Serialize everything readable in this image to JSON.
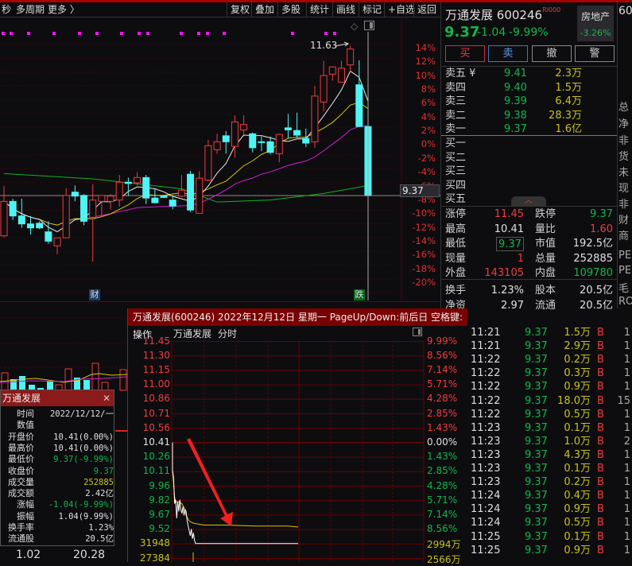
{
  "toolbar": {
    "left": [
      "秒",
      "多周期",
      "更多 〉"
    ],
    "buttons": [
      "复权",
      "叠加",
      "多股",
      "统计",
      "画线",
      "标记",
      "+自选",
      "返回"
    ]
  },
  "kline": {
    "high_label": "11.63",
    "axis": [
      "14%",
      "12%",
      "10%",
      "8%",
      "6%",
      "4%",
      "2%",
      "0%",
      "-2%",
      "-4%",
      "-6%",
      "-8%",
      "-10%",
      "-12%",
      "-14%",
      "-16%",
      "-18%",
      "-20%"
    ],
    "cursor_price": "9.37",
    "badge_cai": "财",
    "badge_die": "跌",
    "bottom_values": [
      "1.02",
      "20.28"
    ]
  },
  "quote": {
    "name": "万通发展",
    "code": "600246",
    "tag": "RI000",
    "price": "9.37",
    "change": "-1.04",
    "pct": "-9.99%",
    "industry": "房地产",
    "industry_pct": "-3.26%",
    "buttons": [
      "买",
      "卖",
      "撤",
      "警"
    ],
    "asks": [
      {
        "label": "卖五 ¥",
        "price": "9.41",
        "vol": "2.3万"
      },
      {
        "label": "卖四",
        "price": "9.40",
        "vol": "1.5万"
      },
      {
        "label": "卖三",
        "price": "9.39",
        "vol": "6.4万"
      },
      {
        "label": "卖二",
        "price": "9.38",
        "vol": "28.3万"
      },
      {
        "label": "卖一",
        "price": "9.37",
        "vol": "1.6亿"
      }
    ],
    "bids": [
      {
        "label": "买一"
      },
      {
        "label": "买二"
      },
      {
        "label": "买三"
      },
      {
        "label": "买四"
      },
      {
        "label": "买五"
      }
    ],
    "collapse": "︿",
    "stats": [
      {
        "l1": "涨停",
        "v1": "11.45",
        "c1": "red",
        "l2": "跌停",
        "v2": "9.37",
        "c2": "green"
      },
      {
        "l1": "最高",
        "v1": "10.41",
        "c1": "white",
        "l2": "量比",
        "v2": "1.60",
        "c2": "red"
      },
      {
        "l1": "最低",
        "v1": "9.37",
        "c1": "green",
        "l2": "市值",
        "v2": "192.5亿",
        "c2": "white"
      },
      {
        "l1": "现量",
        "v1": "1",
        "c1": "red",
        "l2": "总量",
        "v2": "252885",
        "c2": "white"
      },
      {
        "l1": "外盘",
        "v1": "143105",
        "c1": "red",
        "l2": "内盘",
        "v2": "109780",
        "c2": "green"
      },
      {
        "l1": "换手",
        "v1": "1.23%",
        "c1": "white",
        "l2": "股本",
        "v2": "20.5亿",
        "c2": "white"
      },
      {
        "l1": "净资",
        "v1": "2.97",
        "c1": "white",
        "l2": "流通",
        "v2": "20.5亿",
        "c2": "white"
      }
    ]
  },
  "side": {
    "top": "60",
    "items": [
      "总",
      "净",
      "非",
      "货",
      "未",
      "现",
      "非",
      "财",
      "商",
      "PE",
      "PE",
      "毛",
      "RO"
    ]
  },
  "tooltip": {
    "title": "万通发展",
    "close": "✕",
    "rows": [
      {
        "l": "时间",
        "v": "2022/12/12/一",
        "c": "white"
      },
      {
        "l": "数值",
        "v": "",
        "c": "white"
      },
      {
        "l": "开盘价",
        "v": "10.41(0.00%)",
        "c": "white"
      },
      {
        "l": "最高价",
        "v": "10.41(0.00%)",
        "c": "white"
      },
      {
        "l": "最低价",
        "v": "9.37(-9.99%)",
        "c": "green"
      },
      {
        "l": "收盘价",
        "v": "9.37",
        "c": "green"
      },
      {
        "l": "成交量",
        "v": "252885",
        "c": "yellow"
      },
      {
        "l": "成交额",
        "v": "2.42亿",
        "c": "white"
      },
      {
        "l": "涨幅",
        "v": "-1.04(-9.99%)",
        "c": "green"
      },
      {
        "l": "振幅",
        "v": "1.04(9.99%)",
        "c": "white"
      },
      {
        "l": "换手率",
        "v": "1.23%",
        "c": "white"
      },
      {
        "l": "流通股",
        "v": "20.5亿",
        "c": "white"
      }
    ]
  },
  "intraday": {
    "title": "万通发展(600246) 2022年12月12日 星期一 PageUp/Down:前后日 空格键:操作",
    "subtitle": [
      "万通发展",
      "分时"
    ],
    "left_axis": [
      {
        "v": "11.45",
        "c": "red"
      },
      {
        "v": "11.30",
        "c": "red"
      },
      {
        "v": "11.15",
        "c": "red"
      },
      {
        "v": "11.00",
        "c": "red"
      },
      {
        "v": "10.86",
        "c": "red"
      },
      {
        "v": "10.71",
        "c": "red"
      },
      {
        "v": "10.56",
        "c": "red"
      },
      {
        "v": "10.41",
        "c": "white"
      },
      {
        "v": "10.26",
        "c": "green"
      },
      {
        "v": "10.11",
        "c": "green"
      },
      {
        "v": "9.96",
        "c": "green"
      },
      {
        "v": "9.82",
        "c": "green"
      },
      {
        "v": "9.67",
        "c": "green"
      },
      {
        "v": "9.52",
        "c": "green"
      },
      {
        "v": "31948",
        "c": "yellow"
      },
      {
        "v": "27384",
        "c": "yellow"
      }
    ],
    "right_axis": [
      {
        "v": "9.99%",
        "c": "red"
      },
      {
        "v": "8.56%",
        "c": "red"
      },
      {
        "v": "7.14%",
        "c": "red"
      },
      {
        "v": "5.71%",
        "c": "red"
      },
      {
        "v": "4.28%",
        "c": "red"
      },
      {
        "v": "2.85%",
        "c": "red"
      },
      {
        "v": "1.43%",
        "c": "red"
      },
      {
        "v": "0.00%",
        "c": "white"
      },
      {
        "v": "1.43%",
        "c": "green"
      },
      {
        "v": "2.85%",
        "c": "green"
      },
      {
        "v": "4.28%",
        "c": "green"
      },
      {
        "v": "5.71%",
        "c": "green"
      },
      {
        "v": "7.14%",
        "c": "green"
      },
      {
        "v": "8.56%",
        "c": "green"
      },
      {
        "v": "2994万",
        "c": "yellow"
      },
      {
        "v": "2566万",
        "c": "yellow"
      }
    ]
  },
  "trades": [
    [
      "11:21",
      "9.37",
      "1.5万",
      "B",
      "1"
    ],
    [
      "11:21",
      "9.37",
      "2.9万",
      "B",
      "1"
    ],
    [
      "11:22",
      "9.37",
      "0.2万",
      "B",
      "1"
    ],
    [
      "11:22",
      "9.37",
      "0.3万",
      "B",
      "1"
    ],
    [
      "11:22",
      "9.37",
      "0.9万",
      "B",
      "1"
    ],
    [
      "11:22",
      "9.37",
      "18.0万",
      "B",
      "15"
    ],
    [
      "11:22",
      "9.37",
      "0.5万",
      "B",
      "1"
    ],
    [
      "11:23",
      "9.37",
      "0.1万",
      "B",
      "1"
    ],
    [
      "11:23",
      "9.37",
      "1.0万",
      "B",
      "2"
    ],
    [
      "11:23",
      "9.37",
      "4.3万",
      "B",
      "1"
    ],
    [
      "11:23",
      "9.37",
      "0.1万",
      "B",
      "1"
    ],
    [
      "11:23",
      "9.37",
      "0.2万",
      "B",
      "1"
    ],
    [
      "11:24",
      "9.37",
      "0.4万",
      "B",
      "1"
    ],
    [
      "11:24",
      "9.37",
      "0.9万",
      "B",
      "1"
    ],
    [
      "11:24",
      "9.37",
      "0.5万",
      "B",
      "1"
    ],
    [
      "11:25",
      "9.37",
      "0.1万",
      "B",
      "1"
    ],
    [
      "11:25",
      "9.37",
      "0.9万",
      "B",
      "1"
    ]
  ],
  "colors": {
    "up": "#f03c3c",
    "down": "#4ff4f4",
    "ma5": "#e8e8e8",
    "ma10": "#d8c800",
    "ma20": "#d020d0",
    "ma60": "#18b020",
    "avg": "#e0c000"
  },
  "chart_data": [
    {
      "type": "candlestick",
      "title": "万通发展 日K",
      "candles": [
        [
          8.76,
          9.28,
          9.51,
          8.74
        ],
        [
          9.28,
          9.06,
          9.32,
          9.0
        ],
        [
          9.06,
          8.94,
          9.32,
          8.88
        ],
        [
          8.94,
          8.88,
          9.06,
          8.78
        ],
        [
          8.95,
          8.88,
          8.98,
          8.86
        ],
        [
          8.82,
          8.68,
          8.98,
          8.64
        ],
        [
          8.61,
          8.73,
          8.73,
          8.48
        ],
        [
          8.73,
          9.37,
          9.48,
          8.73
        ],
        [
          9.42,
          9.36,
          9.52,
          9.28
        ],
        [
          9.37,
          8.98,
          9.39,
          8.92
        ],
        [
          9.04,
          9.3,
          9.54,
          8.37
        ],
        [
          9.28,
          9.37,
          9.37,
          9.04
        ],
        [
          9.28,
          9.36,
          9.39,
          9.16
        ],
        [
          9.3,
          9.57,
          9.68,
          9.2
        ],
        [
          9.57,
          9.55,
          9.64,
          9.36
        ],
        [
          9.56,
          9.64,
          9.72,
          9.52
        ],
        [
          9.64,
          9.33,
          9.68,
          9.24
        ],
        [
          9.33,
          9.26,
          9.48,
          9.25
        ],
        [
          9.36,
          9.34,
          9.38,
          9.33
        ],
        [
          9.3,
          9.21,
          9.36,
          9.16
        ],
        [
          9.36,
          9.45,
          9.68,
          9.34
        ],
        [
          9.69,
          9.15,
          9.74,
          9.12
        ],
        [
          9.1,
          9.63,
          9.74,
          9.1
        ],
        [
          9.6,
          10.12,
          10.21,
          9.58
        ],
        [
          10.06,
          10.18,
          10.3,
          10.0
        ],
        [
          10.27,
          10.18,
          10.34,
          10.0
        ],
        [
          10.11,
          10.48,
          10.58,
          9.94
        ],
        [
          10.36,
          10.44,
          10.58,
          10.28
        ],
        [
          10.3,
          10.09,
          10.32,
          10.02
        ],
        [
          10.18,
          10.17,
          10.26,
          10.04
        ],
        [
          10.18,
          10.02,
          10.26,
          9.99
        ],
        [
          10.0,
          10.29,
          10.3,
          9.87
        ],
        [
          10.39,
          10.36,
          10.6,
          10.23
        ],
        [
          10.35,
          10.28,
          10.62,
          10.24
        ],
        [
          10.23,
          10.16,
          10.38,
          10.1
        ],
        [
          10.18,
          10.87,
          11.02,
          10.09
        ],
        [
          10.78,
          11.18,
          11.4,
          10.64
        ],
        [
          11.2,
          11.31,
          11.32,
          11.1
        ],
        [
          11.08,
          11.29,
          11.4,
          11.08
        ],
        [
          11.34,
          11.58,
          11.63,
          11.24
        ],
        [
          11.04,
          10.41,
          11.41,
          10.41
        ],
        [
          10.41,
          9.37,
          10.41,
          9.37
        ]
      ],
      "candle_format": [
        "open",
        "close",
        "high",
        "low"
      ],
      "ma60": [
        [
          0,
          9.7
        ],
        [
          10,
          9.62
        ],
        [
          20,
          9.47
        ],
        [
          24,
          9.27
        ],
        [
          30,
          9.3
        ],
        [
          36,
          9.4
        ],
        [
          41,
          9.52
        ]
      ]
    },
    {
      "type": "line",
      "title": "分时",
      "prev_close": 10.41,
      "ylim": [
        9.37,
        11.45
      ],
      "price": [
        [
          0,
          10.41
        ],
        [
          0,
          10.12
        ],
        [
          1,
          10.05
        ],
        [
          2,
          9.78
        ],
        [
          3,
          9.82
        ],
        [
          4,
          9.63
        ],
        [
          5,
          9.8
        ],
        [
          6,
          9.7
        ],
        [
          7,
          9.82
        ],
        [
          8,
          9.72
        ],
        [
          9,
          9.68
        ],
        [
          10,
          9.75
        ],
        [
          11,
          9.66
        ],
        [
          12,
          9.72
        ],
        [
          13,
          9.7
        ],
        [
          14,
          9.6
        ],
        [
          15,
          9.55
        ],
        [
          16,
          9.5
        ],
        [
          17,
          9.45
        ],
        [
          18,
          9.52
        ],
        [
          19,
          9.42
        ],
        [
          20,
          9.48
        ],
        [
          21,
          9.4
        ],
        [
          22,
          9.37
        ],
        [
          120,
          9.37
        ]
      ],
      "avg": [
        [
          0,
          10.12
        ],
        [
          1,
          10.0
        ],
        [
          2,
          9.85
        ],
        [
          3,
          9.8
        ],
        [
          6,
          9.8
        ],
        [
          9,
          9.78
        ],
        [
          11,
          9.74
        ],
        [
          13,
          9.66
        ],
        [
          16,
          9.6
        ],
        [
          20,
          9.58
        ],
        [
          30,
          9.56
        ],
        [
          50,
          9.56
        ],
        [
          80,
          9.55
        ],
        [
          110,
          9.55
        ],
        [
          120,
          9.54
        ]
      ]
    }
  ]
}
